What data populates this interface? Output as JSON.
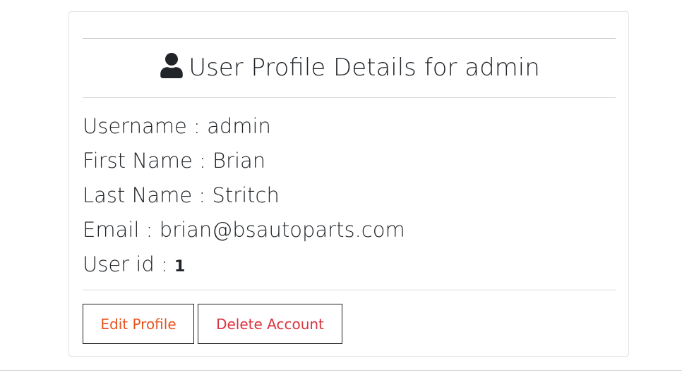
{
  "profile": {
    "title": "User Profile Details for admin",
    "icon": "user-icon",
    "fields": [
      {
        "label": "Username",
        "sep": " : ",
        "value": "admin"
      },
      {
        "label": "First Name",
        "sep": " : ",
        "value": "Brian"
      },
      {
        "label": "Last Name",
        "sep": " : ",
        "value": "Stritch"
      },
      {
        "label": "Email",
        "sep": " : ",
        "value": "brian@bsautoparts.com"
      },
      {
        "label": "User id",
        "sep": " : ",
        "value": "1"
      }
    ]
  },
  "actions": {
    "edit_label": "Edit Profile",
    "delete_label": "Delete Account"
  },
  "colors": {
    "edit": "#e8541f",
    "delete": "#d9343f",
    "text": "#212529"
  }
}
